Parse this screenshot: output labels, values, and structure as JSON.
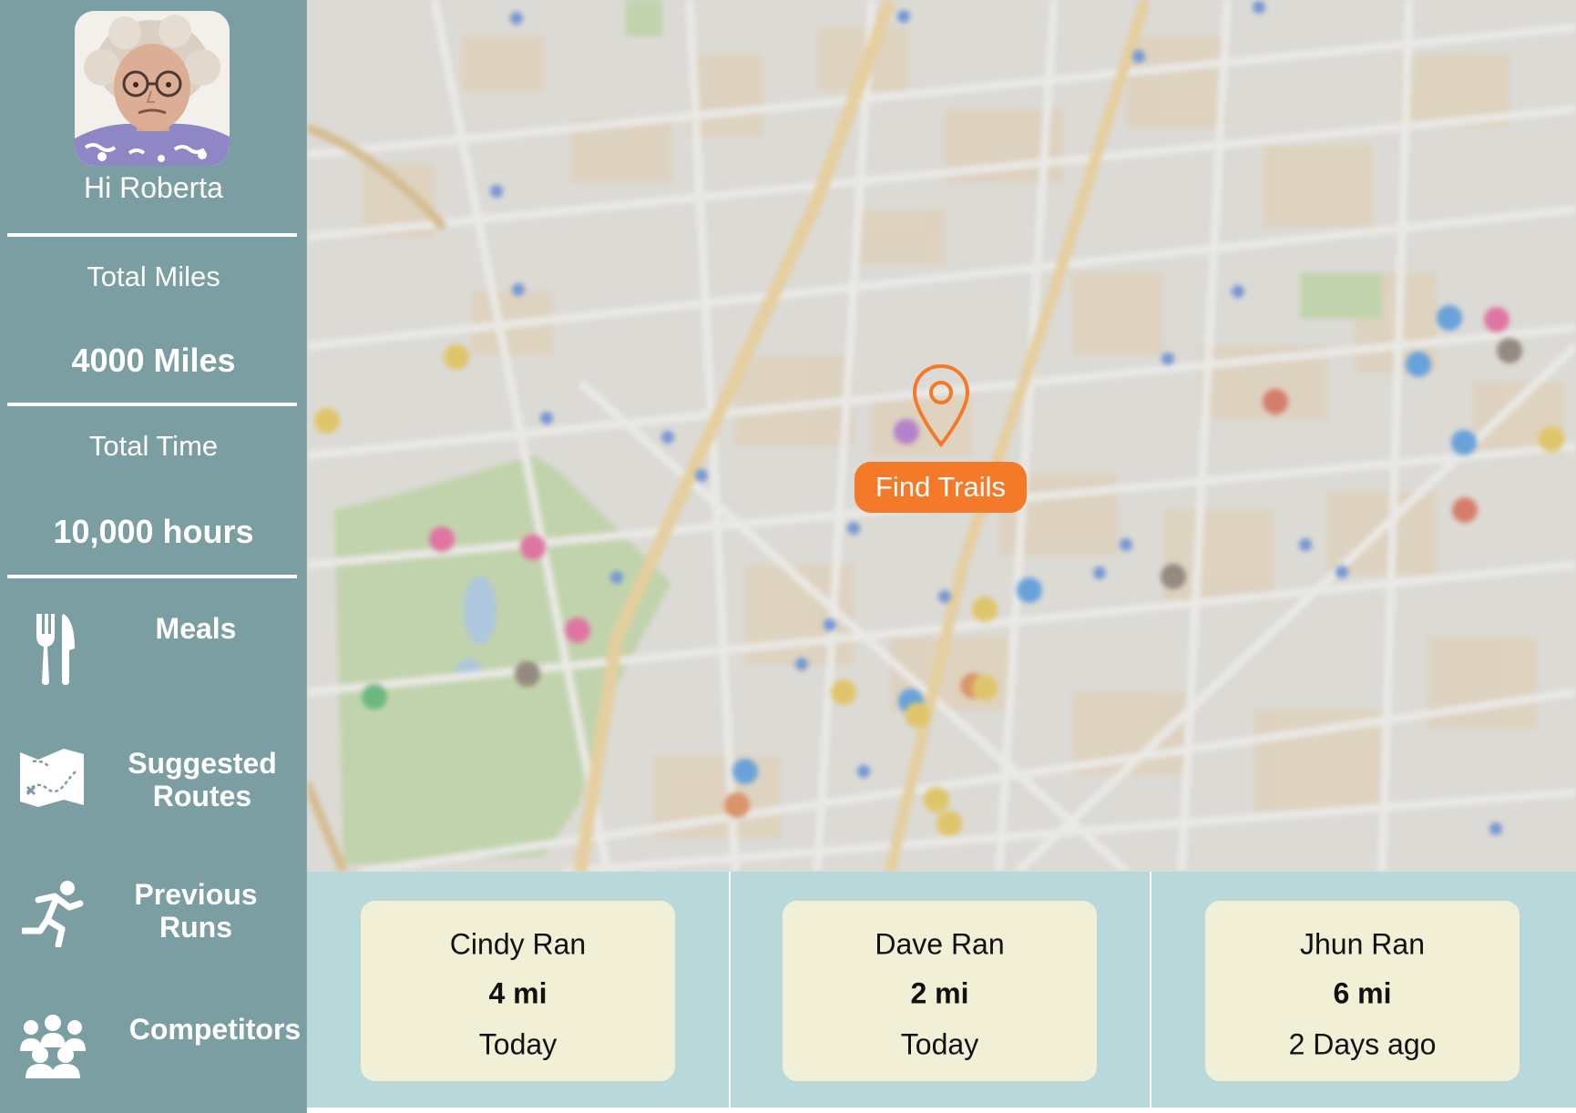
{
  "profile": {
    "greeting": "Hi Roberta",
    "avatar": "user-avatar-photo"
  },
  "stats": {
    "total_miles_label": "Total Miles",
    "total_miles_value": "4000 Miles",
    "total_time_label": "Total Time",
    "total_time_value": "10,000 hours"
  },
  "nav": {
    "meals": {
      "label": "Meals",
      "icon": "fork-knife-icon"
    },
    "routes": {
      "label_line1": "Suggested",
      "label_line2": "Routes",
      "icon": "treasure-map-icon"
    },
    "runs": {
      "label_line1": "Previous",
      "label_line2": "Runs",
      "icon": "runner-icon"
    },
    "competitors": {
      "label": "Competitors",
      "icon": "people-group-icon"
    }
  },
  "map": {
    "find_button": "Find Trails",
    "pin_icon": "location-pin-icon",
    "accent_color": "#f47a2a"
  },
  "activity": [
    {
      "name": "Cindy Ran",
      "distance": "4 mi",
      "when": "Today"
    },
    {
      "name": "Dave Ran",
      "distance": "2 mi",
      "when": "Today"
    },
    {
      "name": "Jhun Ran",
      "distance": "6 mi",
      "when": "2 Days ago"
    }
  ],
  "colors": {
    "sidebar": "#7b9ea2",
    "panel": "#b9d8d9",
    "card": "#f1efd6"
  }
}
